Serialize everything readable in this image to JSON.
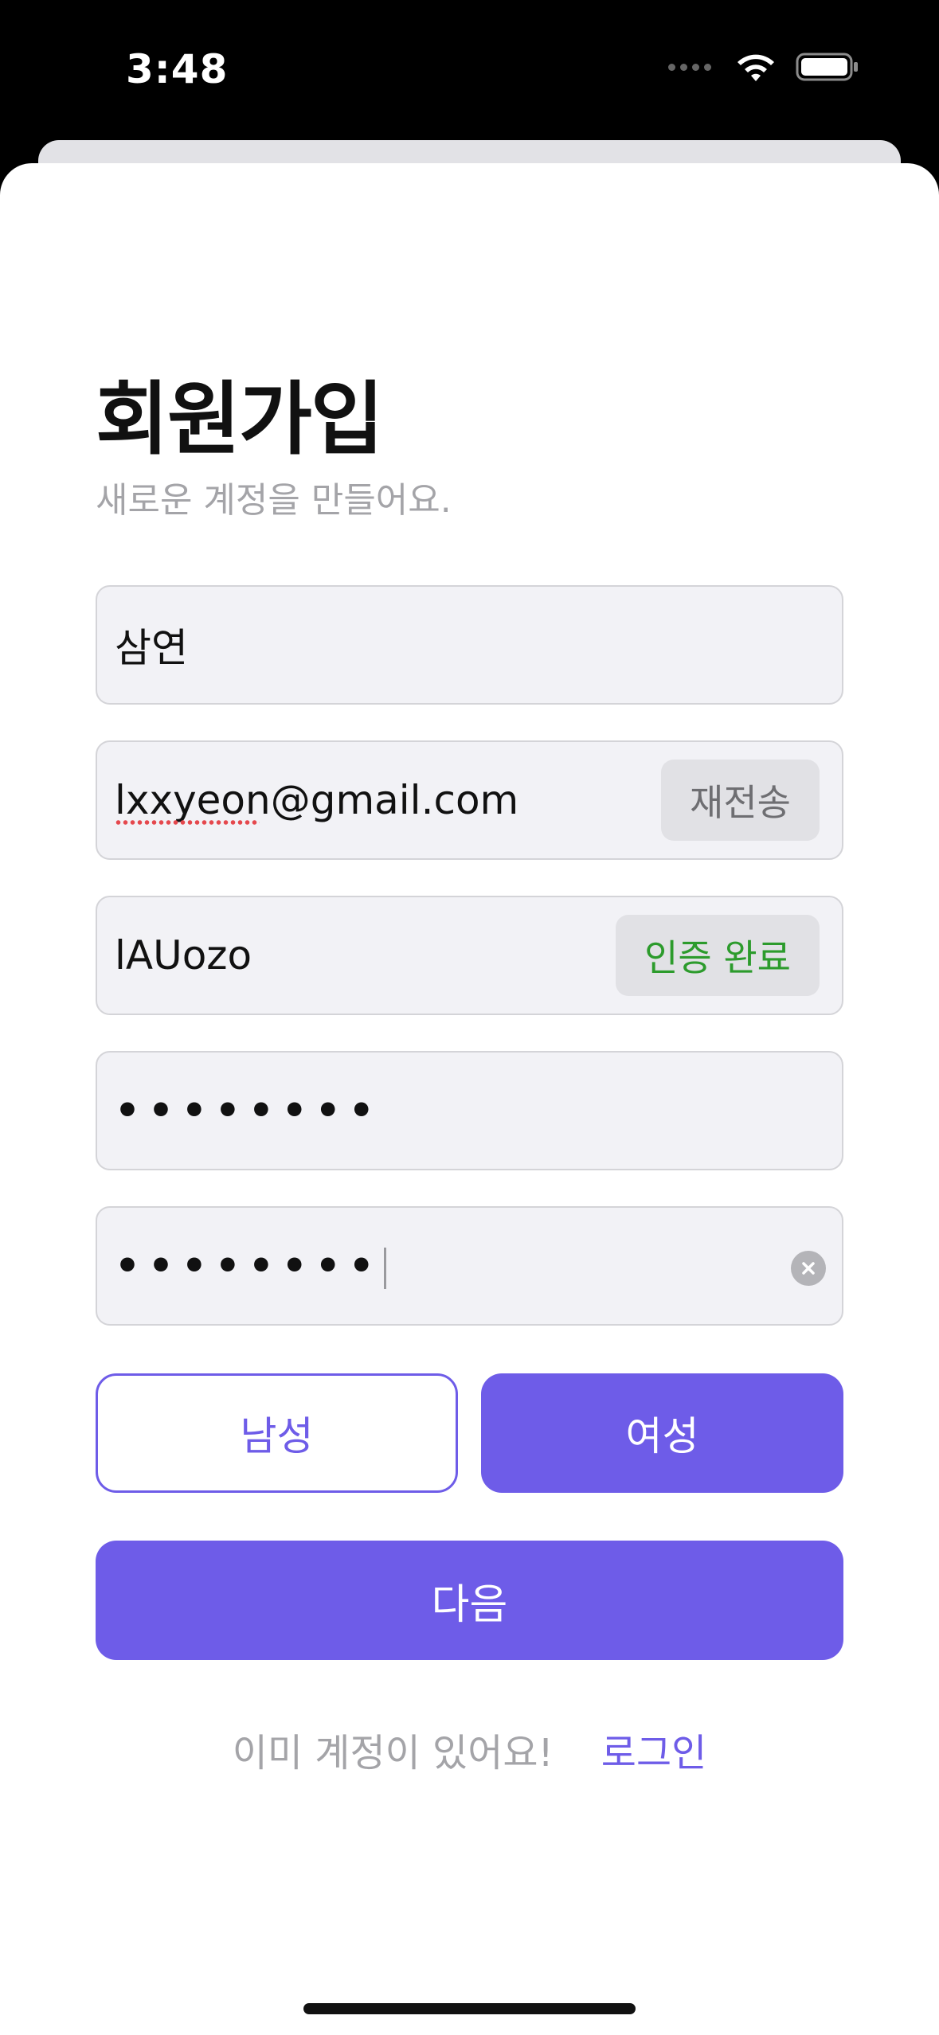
{
  "status_bar": {
    "time": "3:48"
  },
  "header": {
    "title": "회원가입",
    "subtitle": "새로운 계정을 만들어요."
  },
  "form": {
    "name_value": "삼연",
    "email_value": "lxxyeon@gmail.com",
    "email_button_label": "재전송",
    "code_value": "lAUozo",
    "code_button_label": "인증 완료",
    "password_value": "••••••••",
    "password_confirm_value": "••••••••"
  },
  "gender": {
    "male_label": "남성",
    "female_label": "여성",
    "selected": "여성"
  },
  "next_button_label": "다음",
  "footer": {
    "prompt": "이미 계정이 있어요!",
    "login_link": "로그인"
  },
  "colors": {
    "accent": "#6e5ce8",
    "verified": "#2c9b2c",
    "field_bg": "#f2f2f6"
  }
}
